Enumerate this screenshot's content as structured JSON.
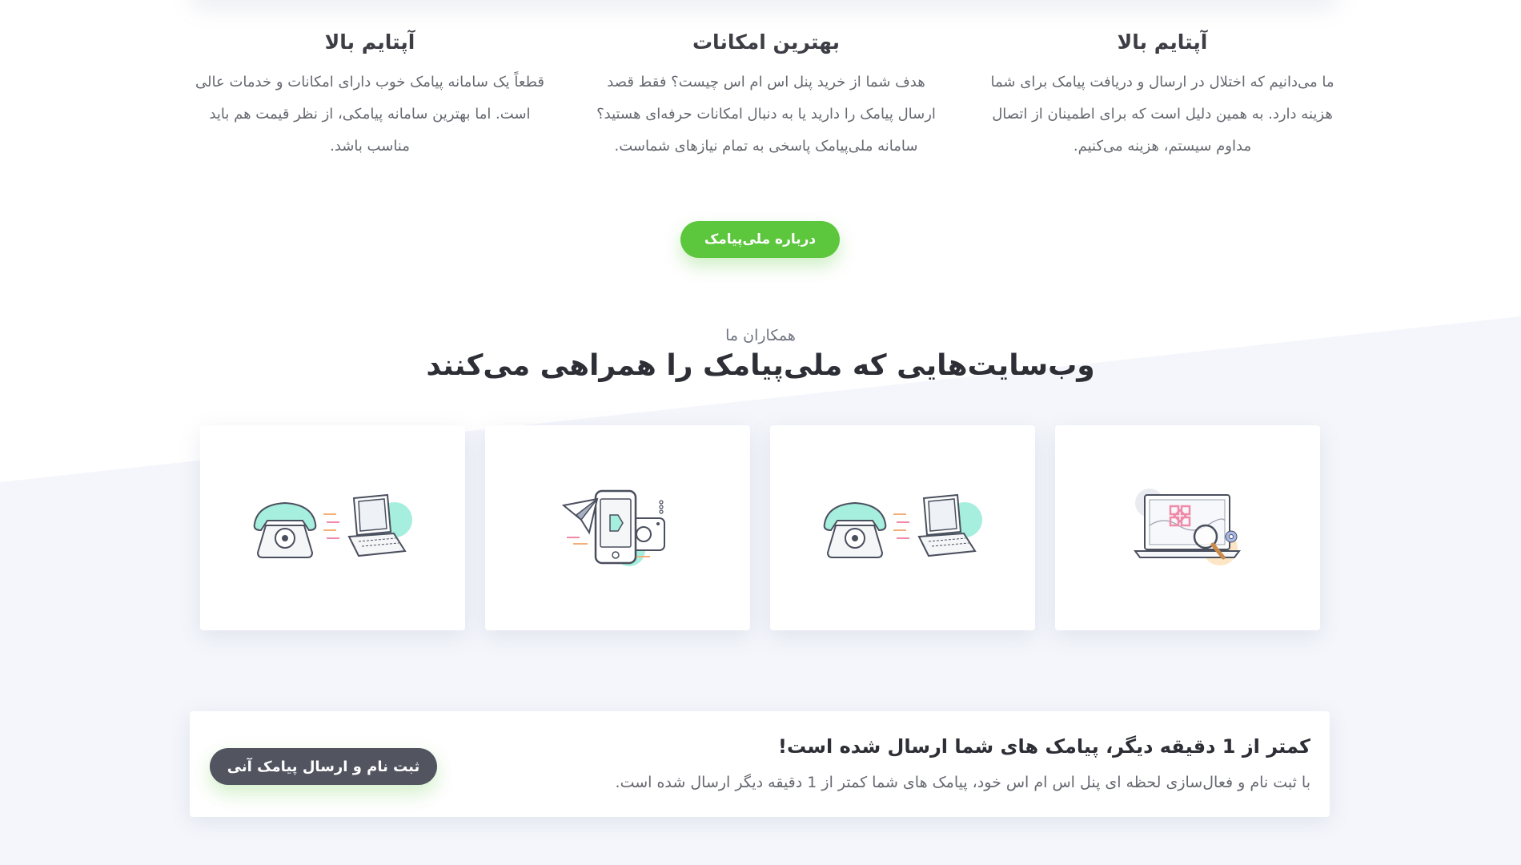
{
  "features": [
    {
      "title": "آپتایم بالا",
      "lines": [
        "قطعاً یک سامانه پیامک خوب دارای امکانات و خدمات عالی",
        "است. اما بهترین سامانه پیامکی، از نظر قیمت هم باید",
        "مناسب باشد."
      ]
    },
    {
      "title": "بهترین امکانات",
      "lines": [
        "هدف شما از خرید پنل اس ام اس چیست؟ فقط قصد",
        "ارسال پیامک را دارید یا به دنبال امکانات حرفه‌ای هستید؟",
        "سامانه ملی‌پیامک پاسخی به تمام نیازهای شماست."
      ]
    },
    {
      "title": "آپتایم بالا",
      "lines": [
        "ما می‌دانیم که اختلال در ارسال و دریافت پیامک برای شما",
        "هزینه دارد. به همین دلیل است که برای اطمینان از اتصال",
        "مداوم سیستم، هزینه می‌کنیم."
      ]
    }
  ],
  "about_button": "درباره ملی‌پیامک",
  "partners": {
    "subtitle": "همکاران ما",
    "title": "وب‌سایت‌هایی که ملی‌پیامک را همراهی می‌کنند",
    "cards": [
      {
        "icon": "phone-laptop-icon"
      },
      {
        "icon": "mobile-telegram-instagram-icon"
      },
      {
        "icon": "phone-laptop-icon"
      },
      {
        "icon": "laptop-search-icon"
      }
    ]
  },
  "cta": {
    "title": "کمتر از 1 دقیقه دیگر، پیامک های شما ارسال شده است!",
    "description": "با ثبت نام و فعال‌سازی لحظه ای پنل اس ام اس خود، پیامک های شما کمتر از 1 دقیقه دیگر ارسال شده است.",
    "button": "ثبت نام و ارسال پیامک آنی"
  },
  "colors": {
    "accent_green": "#5cc63d",
    "dark_button": "#525560",
    "illustration_mint": "#a6eedd",
    "illustration_pink": "#f08aa8",
    "illustration_orange": "#f3b07a"
  }
}
